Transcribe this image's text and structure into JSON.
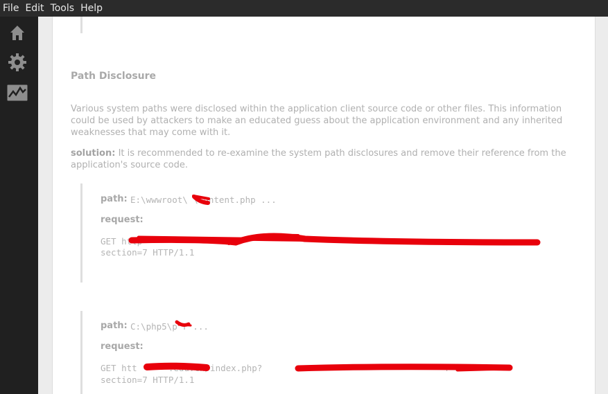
{
  "menu": [
    "File",
    "Edit",
    "Tools",
    "Help"
  ],
  "sidebar_icons": [
    "home-icon",
    "gear-icon",
    "activity-chart-icon"
  ],
  "finding": {
    "title": "Path Disclosure",
    "description": "Various system paths were disclosed within the application client source code or other files. This information could be used by attackers to make an educated guess about the application environment and any inherited weaknesses that may come with it.",
    "solution_label": "solution:",
    "solution_text": "It is recommended to re-examine the system path disclosures and remove their reference from the application's source code."
  },
  "entries": [
    {
      "path_label": "path:",
      "path_value": "E:\\wwwroot\\  \\content.php ...",
      "request_label": "request:",
      "request_line1": "GET http",
      "request_line2": "section=7 HTTP/1.1"
    },
    {
      "path_label": "path:",
      "path_value": "C:\\php5\\p  r ...",
      "request_label": "request:",
      "request_line1": "GET htt      .edu.cn/index.php?                                   r=2&",
      "request_line2": "section=7 HTTP/1.1"
    }
  ],
  "colors": {
    "menubar": "#2b2b2b",
    "sidebar": "#202020",
    "redaction": "#e8000b"
  }
}
